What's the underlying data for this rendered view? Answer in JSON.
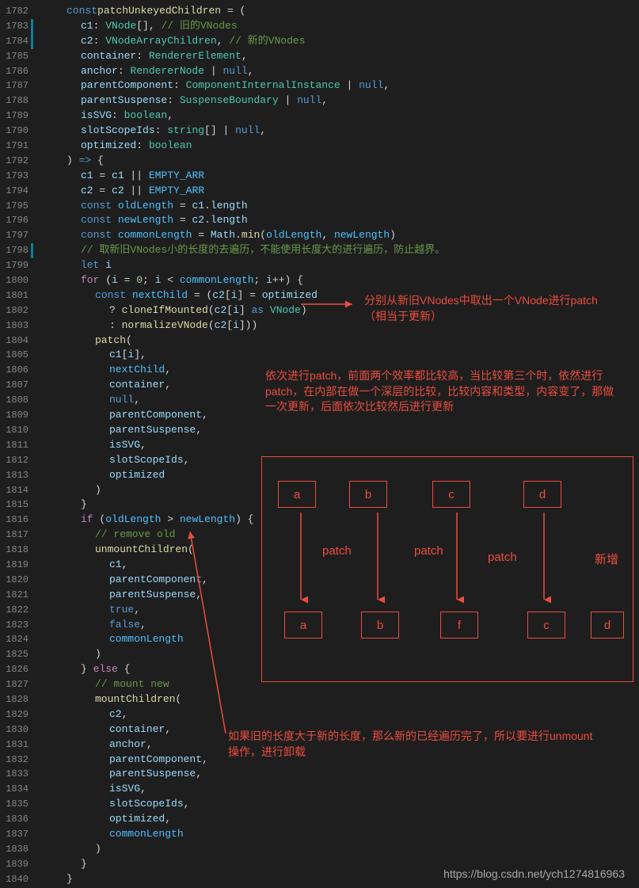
{
  "lineStart": 1782,
  "lineEnd": 1840,
  "modifiedLines": [
    1783,
    1784,
    1798
  ],
  "code": [
    {
      "i": 1,
      "t": [
        [
          " ",
          "kw",
          "const"
        ],
        [
          " ",
          "fn",
          "patchUnkeyedChildren"
        ],
        [
          " ",
          "op",
          " = ("
        ]
      ]
    },
    {
      "i": 2,
      "t": [
        [
          "",
          "var",
          "c1"
        ],
        [
          "",
          "op",
          ": "
        ],
        [
          "",
          "type",
          "VNode"
        ],
        [
          "",
          "op",
          "[], "
        ],
        [
          "",
          "comment",
          "// 旧的VNodes"
        ]
      ]
    },
    {
      "i": 2,
      "t": [
        [
          "",
          "var",
          "c2"
        ],
        [
          "",
          "op",
          ": "
        ],
        [
          "",
          "type",
          "VNodeArrayChildren"
        ],
        [
          "",
          "op",
          ", "
        ],
        [
          "",
          "comment",
          "// 新的VNodes"
        ]
      ]
    },
    {
      "i": 2,
      "t": [
        [
          "",
          "var",
          "container"
        ],
        [
          "",
          "op",
          ": "
        ],
        [
          "",
          "type",
          "RendererElement"
        ],
        [
          "",
          "op",
          ","
        ]
      ]
    },
    {
      "i": 2,
      "t": [
        [
          "",
          "var",
          "anchor"
        ],
        [
          "",
          "op",
          ": "
        ],
        [
          "",
          "type",
          "RendererNode"
        ],
        [
          "",
          "op",
          " | "
        ],
        [
          "",
          "kw",
          "null"
        ],
        [
          "",
          "op",
          ","
        ]
      ]
    },
    {
      "i": 2,
      "t": [
        [
          "",
          "var",
          "parentComponent"
        ],
        [
          "",
          "op",
          ": "
        ],
        [
          "",
          "type",
          "ComponentInternalInstance"
        ],
        [
          "",
          "op",
          " | "
        ],
        [
          "",
          "kw",
          "null"
        ],
        [
          "",
          "op",
          ","
        ]
      ]
    },
    {
      "i": 2,
      "t": [
        [
          "",
          "var",
          "parentSuspense"
        ],
        [
          "",
          "op",
          ": "
        ],
        [
          "",
          "type",
          "SuspenseBoundary"
        ],
        [
          "",
          "op",
          " | "
        ],
        [
          "",
          "kw",
          "null"
        ],
        [
          "",
          "op",
          ","
        ]
      ]
    },
    {
      "i": 2,
      "t": [
        [
          "",
          "var",
          "isSVG"
        ],
        [
          "",
          "op",
          ": "
        ],
        [
          "",
          "type",
          "boolean"
        ],
        [
          "",
          "op",
          ","
        ]
      ]
    },
    {
      "i": 2,
      "t": [
        [
          "",
          "var",
          "slotScopeIds"
        ],
        [
          "",
          "op",
          ": "
        ],
        [
          "",
          "type",
          "string"
        ],
        [
          "",
          "op",
          "[] | "
        ],
        [
          "",
          "kw",
          "null"
        ],
        [
          "",
          "op",
          ","
        ]
      ]
    },
    {
      "i": 2,
      "t": [
        [
          "",
          "var",
          "optimized"
        ],
        [
          "",
          "op",
          ": "
        ],
        [
          "",
          "type",
          "boolean"
        ]
      ]
    },
    {
      "i": 1,
      "t": [
        [
          "",
          "op",
          ") "
        ],
        [
          "",
          "kw",
          "=>"
        ],
        [
          "",
          "op",
          " {"
        ]
      ]
    },
    {
      "i": 2,
      "t": [
        [
          "",
          "var",
          "c1"
        ],
        [
          "",
          "op",
          " = "
        ],
        [
          "",
          "var",
          "c1"
        ],
        [
          "",
          "op",
          " || "
        ],
        [
          "",
          "const-var",
          "EMPTY_ARR"
        ]
      ]
    },
    {
      "i": 2,
      "t": [
        [
          "",
          "var",
          "c2"
        ],
        [
          "",
          "op",
          " = "
        ],
        [
          "",
          "var",
          "c2"
        ],
        [
          "",
          "op",
          " || "
        ],
        [
          "",
          "const-var",
          "EMPTY_ARR"
        ]
      ]
    },
    {
      "i": 2,
      "t": [
        [
          "",
          "kw",
          "const"
        ],
        [
          "",
          "op",
          " "
        ],
        [
          "",
          "const-var",
          "oldLength"
        ],
        [
          "",
          "op",
          " = "
        ],
        [
          "",
          "var",
          "c1"
        ],
        [
          "",
          "op",
          "."
        ],
        [
          "",
          "prop",
          "length"
        ]
      ]
    },
    {
      "i": 2,
      "t": [
        [
          "",
          "kw",
          "const"
        ],
        [
          "",
          "op",
          " "
        ],
        [
          "",
          "const-var",
          "newLength"
        ],
        [
          "",
          "op",
          " = "
        ],
        [
          "",
          "var",
          "c2"
        ],
        [
          "",
          "op",
          "."
        ],
        [
          "",
          "prop",
          "length"
        ]
      ]
    },
    {
      "i": 2,
      "t": [
        [
          "",
          "kw",
          "const"
        ],
        [
          "",
          "op",
          " "
        ],
        [
          "",
          "const-var",
          "commonLength"
        ],
        [
          "",
          "op",
          " = "
        ],
        [
          "",
          "var",
          "Math"
        ],
        [
          "",
          "op",
          "."
        ],
        [
          "",
          "fn",
          "min"
        ],
        [
          "",
          "op",
          "("
        ],
        [
          "",
          "const-var",
          "oldLength"
        ],
        [
          "",
          "op",
          ", "
        ],
        [
          "",
          "const-var",
          "newLength"
        ],
        [
          "",
          "op",
          ")"
        ]
      ]
    },
    {
      "i": 2,
      "t": [
        [
          "",
          "comment",
          "// 取新旧VNodes小的长度的去遍历，不能使用长度大的进行遍历，防止越界。"
        ]
      ]
    },
    {
      "i": 2,
      "t": [
        [
          "",
          "kw",
          "let"
        ],
        [
          "",
          "op",
          " "
        ],
        [
          "",
          "var",
          "i"
        ]
      ]
    },
    {
      "i": 2,
      "t": [
        [
          "",
          "ctrl",
          "for"
        ],
        [
          "",
          "op",
          " ("
        ],
        [
          "",
          "var",
          "i"
        ],
        [
          "",
          "op",
          " = "
        ],
        [
          "",
          "num",
          "0"
        ],
        [
          "",
          "op",
          "; "
        ],
        [
          "",
          "var",
          "i"
        ],
        [
          "",
          "op",
          " < "
        ],
        [
          "",
          "const-var",
          "commonLength"
        ],
        [
          "",
          "op",
          "; "
        ],
        [
          "",
          "var",
          "i"
        ],
        [
          "",
          "op",
          "++) {"
        ]
      ]
    },
    {
      "i": 3,
      "t": [
        [
          "",
          "kw",
          "const"
        ],
        [
          "",
          "op",
          " "
        ],
        [
          "",
          "const-var",
          "nextChild"
        ],
        [
          "",
          "op",
          " = ("
        ],
        [
          "",
          "var",
          "c2"
        ],
        [
          "",
          "op",
          "["
        ],
        [
          "",
          "var",
          "i"
        ],
        [
          "",
          "op",
          "] = "
        ],
        [
          "",
          "var",
          "optimized"
        ]
      ]
    },
    {
      "i": 4,
      "t": [
        [
          "",
          "op",
          "? "
        ],
        [
          "",
          "fn",
          "cloneIfMounted"
        ],
        [
          "",
          "op",
          "("
        ],
        [
          "",
          "var",
          "c2"
        ],
        [
          "",
          "op",
          "["
        ],
        [
          "",
          "var",
          "i"
        ],
        [
          "",
          "op",
          "] "
        ],
        [
          "",
          "kw",
          "as"
        ],
        [
          "",
          "op",
          " "
        ],
        [
          "",
          "type",
          "VNode"
        ],
        [
          "",
          "op",
          ")"
        ]
      ]
    },
    {
      "i": 4,
      "t": [
        [
          "",
          "op",
          ": "
        ],
        [
          "",
          "fn",
          "normalizeVNode"
        ],
        [
          "",
          "op",
          "("
        ],
        [
          "",
          "var",
          "c2"
        ],
        [
          "",
          "op",
          "["
        ],
        [
          "",
          "var",
          "i"
        ],
        [
          "",
          "op",
          "]))"
        ]
      ]
    },
    {
      "i": 3,
      "t": [
        [
          "",
          "fn",
          "patch"
        ],
        [
          "",
          "op",
          "("
        ]
      ]
    },
    {
      "i": 4,
      "t": [
        [
          "",
          "var",
          "c1"
        ],
        [
          "",
          "op",
          "["
        ],
        [
          "",
          "var",
          "i"
        ],
        [
          "",
          "op",
          "],"
        ]
      ]
    },
    {
      "i": 4,
      "t": [
        [
          "",
          "const-var",
          "nextChild"
        ],
        [
          "",
          "op",
          ","
        ]
      ]
    },
    {
      "i": 4,
      "t": [
        [
          "",
          "var",
          "container"
        ],
        [
          "",
          "op",
          ","
        ]
      ]
    },
    {
      "i": 4,
      "t": [
        [
          "",
          "kw",
          "null"
        ],
        [
          "",
          "op",
          ","
        ]
      ]
    },
    {
      "i": 4,
      "t": [
        [
          "",
          "var",
          "parentComponent"
        ],
        [
          "",
          "op",
          ","
        ]
      ]
    },
    {
      "i": 4,
      "t": [
        [
          "",
          "var",
          "parentSuspense"
        ],
        [
          "",
          "op",
          ","
        ]
      ]
    },
    {
      "i": 4,
      "t": [
        [
          "",
          "var",
          "isSVG"
        ],
        [
          "",
          "op",
          ","
        ]
      ]
    },
    {
      "i": 4,
      "t": [
        [
          "",
          "var",
          "slotScopeIds"
        ],
        [
          "",
          "op",
          ","
        ]
      ]
    },
    {
      "i": 4,
      "t": [
        [
          "",
          "var",
          "optimized"
        ]
      ]
    },
    {
      "i": 3,
      "t": [
        [
          "",
          "op",
          ")"
        ]
      ]
    },
    {
      "i": 2,
      "t": [
        [
          "",
          "op",
          "}"
        ]
      ]
    },
    {
      "i": 2,
      "t": [
        [
          "",
          "ctrl",
          "if"
        ],
        [
          "",
          "op",
          " ("
        ],
        [
          "",
          "const-var",
          "oldLength"
        ],
        [
          "",
          "op",
          " > "
        ],
        [
          "",
          "const-var",
          "newLength"
        ],
        [
          "",
          "op",
          ") {"
        ]
      ]
    },
    {
      "i": 3,
      "t": [
        [
          "",
          "comment",
          "// remove old"
        ]
      ]
    },
    {
      "i": 3,
      "t": [
        [
          "",
          "fn",
          "unmountChildren"
        ],
        [
          "",
          "op",
          "("
        ]
      ]
    },
    {
      "i": 4,
      "t": [
        [
          "",
          "var",
          "c1"
        ],
        [
          "",
          "op",
          ","
        ]
      ]
    },
    {
      "i": 4,
      "t": [
        [
          "",
          "var",
          "parentComponent"
        ],
        [
          "",
          "op",
          ","
        ]
      ]
    },
    {
      "i": 4,
      "t": [
        [
          "",
          "var",
          "parentSuspense"
        ],
        [
          "",
          "op",
          ","
        ]
      ]
    },
    {
      "i": 4,
      "t": [
        [
          "",
          "kw",
          "true"
        ],
        [
          "",
          "op",
          ","
        ]
      ]
    },
    {
      "i": 4,
      "t": [
        [
          "",
          "kw",
          "false"
        ],
        [
          "",
          "op",
          ","
        ]
      ]
    },
    {
      "i": 4,
      "t": [
        [
          "",
          "const-var",
          "commonLength"
        ]
      ]
    },
    {
      "i": 3,
      "t": [
        [
          "",
          "op",
          ")"
        ]
      ]
    },
    {
      "i": 2,
      "t": [
        [
          "",
          "op",
          "} "
        ],
        [
          "",
          "ctrl",
          "else"
        ],
        [
          "",
          "op",
          " {"
        ]
      ]
    },
    {
      "i": 3,
      "t": [
        [
          "",
          "comment",
          "// mount new"
        ]
      ]
    },
    {
      "i": 3,
      "t": [
        [
          "",
          "fn",
          "mountChildren"
        ],
        [
          "",
          "op",
          "("
        ]
      ]
    },
    {
      "i": 4,
      "t": [
        [
          "",
          "var",
          "c2"
        ],
        [
          "",
          "op",
          ","
        ]
      ]
    },
    {
      "i": 4,
      "t": [
        [
          "",
          "var",
          "container"
        ],
        [
          "",
          "op",
          ","
        ]
      ]
    },
    {
      "i": 4,
      "t": [
        [
          "",
          "var",
          "anchor"
        ],
        [
          "",
          "op",
          ","
        ]
      ]
    },
    {
      "i": 4,
      "t": [
        [
          "",
          "var",
          "parentComponent"
        ],
        [
          "",
          "op",
          ","
        ]
      ]
    },
    {
      "i": 4,
      "t": [
        [
          "",
          "var",
          "parentSuspense"
        ],
        [
          "",
          "op",
          ","
        ]
      ]
    },
    {
      "i": 4,
      "t": [
        [
          "",
          "var",
          "isSVG"
        ],
        [
          "",
          "op",
          ","
        ]
      ]
    },
    {
      "i": 4,
      "t": [
        [
          "",
          "var",
          "slotScopeIds"
        ],
        [
          "",
          "op",
          ","
        ]
      ]
    },
    {
      "i": 4,
      "t": [
        [
          "",
          "var",
          "optimized"
        ],
        [
          "",
          "op",
          ","
        ]
      ]
    },
    {
      "i": 4,
      "t": [
        [
          "",
          "const-var",
          "commonLength"
        ]
      ]
    },
    {
      "i": 3,
      "t": [
        [
          "",
          "op",
          ")"
        ]
      ]
    },
    {
      "i": 2,
      "t": [
        [
          "",
          "op",
          "}"
        ]
      ]
    },
    {
      "i": 1,
      "t": [
        [
          "",
          "op",
          "}"
        ]
      ]
    }
  ],
  "annotations": {
    "a1": "分别从新旧VNodes中取出一个VNode进行patch（相当于更新）",
    "a2": "依次进行patch，前面两个效率都比较高，当比较第三个时，依然进行patch，在内部在做一个深层的比较，比较内容和类型，内容变了，那做一次更新，后面依次比较然后进行更新",
    "a3": "如果旧的长度大于新的长度，那么新的已经遍历完了，所以要进行unmount操作，进行卸载",
    "newAdd": "新增"
  },
  "diagram": {
    "topRow": [
      "a",
      "b",
      "c",
      "d"
    ],
    "bottomRow": [
      "a",
      "b",
      "f",
      "c",
      "d"
    ],
    "patchLabel": "patch"
  },
  "watermark": "https://blog.csdn.net/ych1274816963"
}
